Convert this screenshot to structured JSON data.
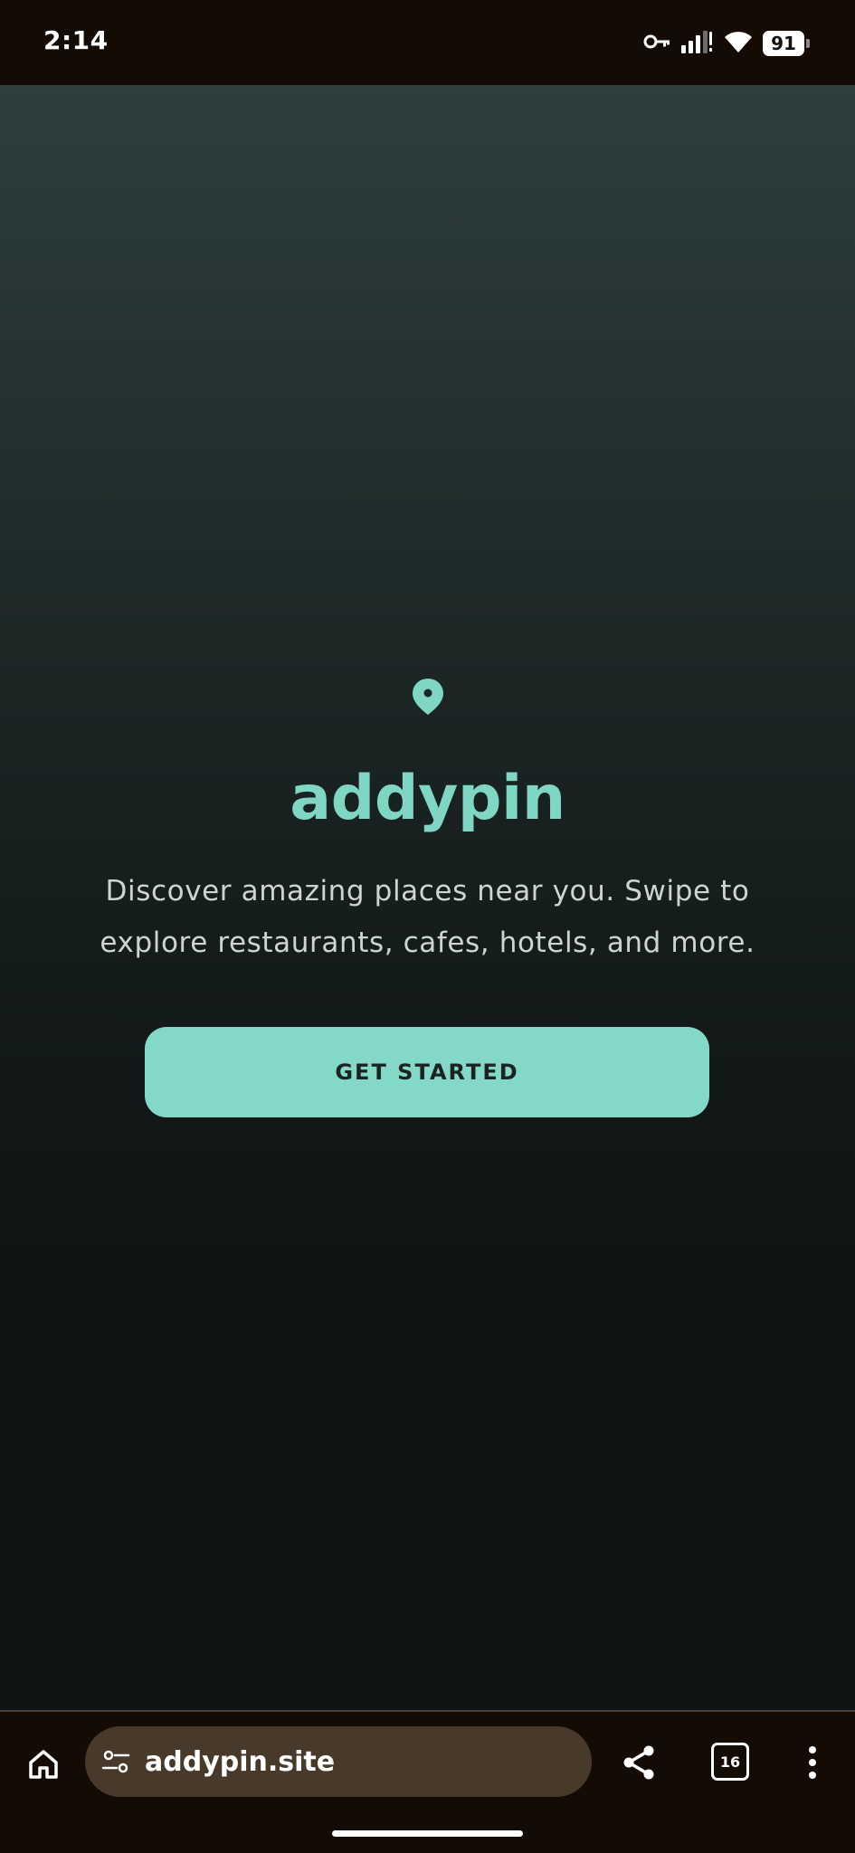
{
  "status_bar": {
    "time": "2:14",
    "battery": "91",
    "icons": [
      "vpn-key-icon",
      "signal-icon",
      "wifi-icon",
      "battery-icon"
    ]
  },
  "hero": {
    "icon": "map-pin-icon",
    "brand": "addypin",
    "tagline": "Discover amazing places near you. Swipe to explore restaurants, cafes, hotels, and more.",
    "cta_label": "GET STARTED"
  },
  "browser": {
    "url": "addypin.site",
    "tab_count": "16",
    "icons": [
      "home-icon",
      "site-settings-icon",
      "share-icon",
      "tabs-icon",
      "more-icon"
    ]
  },
  "colors": {
    "accent": "#7fd6c3",
    "button": "#83d8c7",
    "status_bar_bg": "#140c04",
    "url_pill_bg": "#473a2b"
  }
}
